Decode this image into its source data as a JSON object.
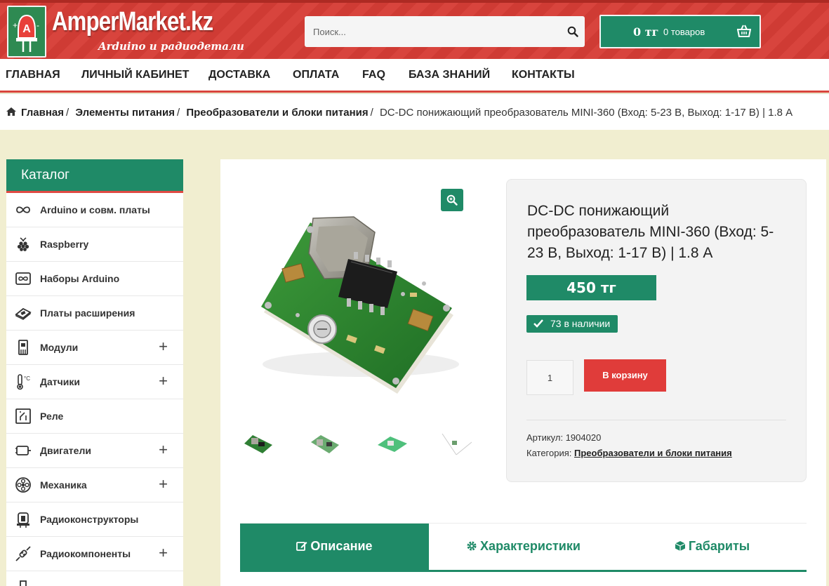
{
  "header": {
    "logo_title": "AmperMarket.kz",
    "logo_subtitle": "Arduino и радиодетали",
    "search_placeholder": "Поиск...",
    "cart_sum": "0 тг",
    "cart_count": "0 товаров"
  },
  "nav": {
    "items": [
      {
        "label": "ГЛАВНАЯ"
      },
      {
        "label": "ЛИЧНЫЙ КАБИНЕТ"
      },
      {
        "label": "ДОСТАВКА"
      },
      {
        "label": "ОПЛАТА"
      },
      {
        "label": "FAQ"
      },
      {
        "label": "БАЗА ЗНАНИЙ"
      },
      {
        "label": "КОНТАКТЫ"
      }
    ]
  },
  "breadcrumb": {
    "items": [
      "Главная",
      "Элементы питания",
      "Преобразователи и блоки питания"
    ],
    "current": "DC-DC понижающий преобразователь MINI-360 (Вход: 5-23 В, Выход: 1-17 В) | 1.8 А"
  },
  "catalog": {
    "title": "Каталог",
    "items": [
      {
        "label": "Arduino и совм. платы",
        "icon": "infinity-icon",
        "expandable": false
      },
      {
        "label": "Raspberry",
        "icon": "raspberry-icon",
        "expandable": false
      },
      {
        "label": "Наборы Arduino",
        "icon": "kit-box-icon",
        "expandable": false
      },
      {
        "label": "Платы расширения",
        "icon": "shield-board-icon",
        "expandable": false
      },
      {
        "label": "Модули",
        "icon": "module-icon",
        "expandable": true
      },
      {
        "label": "Датчики",
        "icon": "thermometer-icon",
        "expandable": true
      },
      {
        "label": "Реле",
        "icon": "relay-icon",
        "expandable": false
      },
      {
        "label": "Двигатели",
        "icon": "motor-icon",
        "expandable": true
      },
      {
        "label": "Механика",
        "icon": "gear-wheel-icon",
        "expandable": true
      },
      {
        "label": "Радиоконструкторы",
        "icon": "constructor-icon",
        "expandable": false
      },
      {
        "label": "Радиокомпоненты",
        "icon": "resistor-icon",
        "expandable": true
      }
    ],
    "plus_symbol": "+"
  },
  "product": {
    "title": "DC-DC понижающий преобразователь MINI-360 (Вход: 5-23 В, Выход: 1-17 В) | 1.8 А",
    "price": "450 тг",
    "stock": "73 в наличии",
    "quantity": "1",
    "add_to_cart": "В корзину",
    "sku_label": "Артикул:",
    "sku": "1904020",
    "category_label": "Категория:",
    "category": "Преобразователи и блоки питания"
  },
  "tabs": [
    {
      "label": "Описание",
      "icon": "edit-icon",
      "active": true
    },
    {
      "label": "Характеристики",
      "icon": "cog-icon",
      "active": false
    },
    {
      "label": "Габариты",
      "icon": "cube-icon",
      "active": false
    }
  ],
  "colors": {
    "brand_red": "#d8443d",
    "brand_green": "#1f8a67",
    "cart_red": "#e03c3a",
    "page_bg": "#f1eed0"
  }
}
